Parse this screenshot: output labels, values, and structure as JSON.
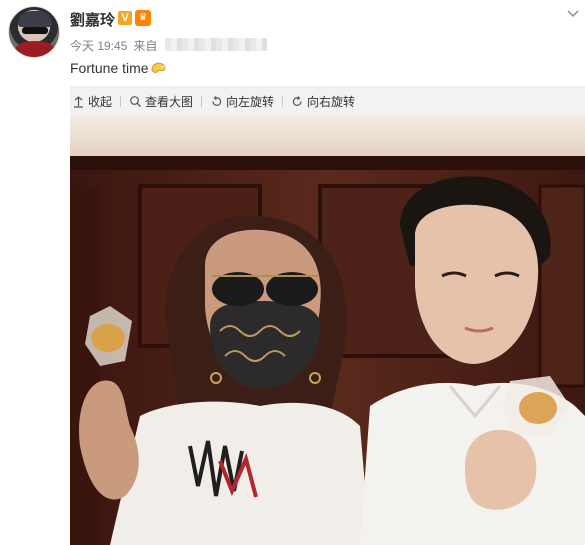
{
  "post": {
    "username": "劉嘉玲",
    "verified_badge": "V",
    "time_label": "今天 19:45",
    "from_label": "来自",
    "text": "Fortune time",
    "icons": {
      "avatar": "user-avatar",
      "verified": "verified-v-icon",
      "member": "member-crown-icon",
      "fortune": "fortune-cookie-emoji-icon",
      "menu": "chevron-down-icon"
    }
  },
  "media_toolbar": {
    "collapse_label": "收起",
    "view_large_label": "查看大图",
    "rotate_left_label": "向左旋转",
    "rotate_right_label": "向右旋转"
  },
  "colors": {
    "accent_orange": "#ff8200",
    "verified_gold": "#f5a623",
    "meta_gray": "#808080",
    "toolbar_bg": "#f2f2f5"
  }
}
